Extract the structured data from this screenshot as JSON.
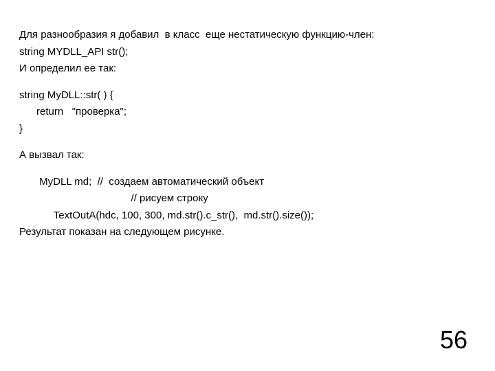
{
  "lines": {
    "l1": "Для разнообразия я добавил  в класс  еще нестатическую функцию-член:",
    "l2": "string MYDLL_API str();",
    "l3": "И определил ее так:",
    "l4": "string MyDLL::str( ) {",
    "l5": "      return   \"проверка\";",
    "l6": "}",
    "l7": "А вызвал так:",
    "l8": "       MyDLL md;  //  создаем автоматический объект",
    "l9": "                                       // рисуем строку",
    "l10": "            TextOutA(hdc, 100, 300, md.str().c_str(),  md.str().size());",
    "l11": "Результат показан на следующем рисунке."
  },
  "page_number": "56"
}
